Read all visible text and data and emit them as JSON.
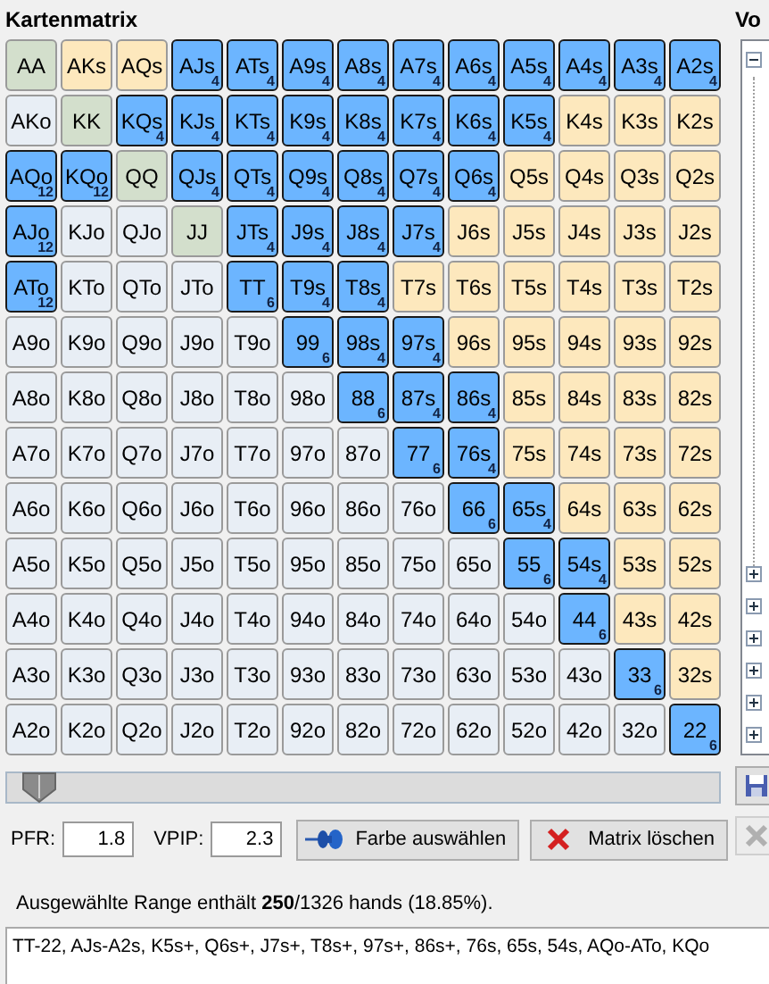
{
  "matrix": {
    "title": "Kartenmatrix",
    "rows": [
      [
        {
          "label": "AA",
          "kind": "pair",
          "selected": false
        },
        {
          "label": "AKs",
          "kind": "suited",
          "selected": false
        },
        {
          "label": "AQs",
          "kind": "suited",
          "selected": false
        },
        {
          "label": "AJs",
          "kind": "suited",
          "selected": true,
          "count": "4"
        },
        {
          "label": "ATs",
          "kind": "suited",
          "selected": true,
          "count": "4"
        },
        {
          "label": "A9s",
          "kind": "suited",
          "selected": true,
          "count": "4"
        },
        {
          "label": "A8s",
          "kind": "suited",
          "selected": true,
          "count": "4"
        },
        {
          "label": "A7s",
          "kind": "suited",
          "selected": true,
          "count": "4"
        },
        {
          "label": "A6s",
          "kind": "suited",
          "selected": true,
          "count": "4"
        },
        {
          "label": "A5s",
          "kind": "suited",
          "selected": true,
          "count": "4"
        },
        {
          "label": "A4s",
          "kind": "suited",
          "selected": true,
          "count": "4"
        },
        {
          "label": "A3s",
          "kind": "suited",
          "selected": true,
          "count": "4"
        },
        {
          "label": "A2s",
          "kind": "suited",
          "selected": true,
          "count": "4"
        }
      ],
      [
        {
          "label": "AKo",
          "kind": "offsuit",
          "selected": false
        },
        {
          "label": "KK",
          "kind": "pair",
          "selected": false
        },
        {
          "label": "KQs",
          "kind": "suited",
          "selected": true,
          "count": "4"
        },
        {
          "label": "KJs",
          "kind": "suited",
          "selected": true,
          "count": "4"
        },
        {
          "label": "KTs",
          "kind": "suited",
          "selected": true,
          "count": "4"
        },
        {
          "label": "K9s",
          "kind": "suited",
          "selected": true,
          "count": "4"
        },
        {
          "label": "K8s",
          "kind": "suited",
          "selected": true,
          "count": "4"
        },
        {
          "label": "K7s",
          "kind": "suited",
          "selected": true,
          "count": "4"
        },
        {
          "label": "K6s",
          "kind": "suited",
          "selected": true,
          "count": "4"
        },
        {
          "label": "K5s",
          "kind": "suited",
          "selected": true,
          "count": "4"
        },
        {
          "label": "K4s",
          "kind": "suited",
          "selected": false
        },
        {
          "label": "K3s",
          "kind": "suited",
          "selected": false
        },
        {
          "label": "K2s",
          "kind": "suited",
          "selected": false
        }
      ],
      [
        {
          "label": "AQo",
          "kind": "offsuit",
          "selected": true,
          "count": "12"
        },
        {
          "label": "KQo",
          "kind": "offsuit",
          "selected": true,
          "count": "12"
        },
        {
          "label": "QQ",
          "kind": "pair",
          "selected": false
        },
        {
          "label": "QJs",
          "kind": "suited",
          "selected": true,
          "count": "4"
        },
        {
          "label": "QTs",
          "kind": "suited",
          "selected": true,
          "count": "4"
        },
        {
          "label": "Q9s",
          "kind": "suited",
          "selected": true,
          "count": "4"
        },
        {
          "label": "Q8s",
          "kind": "suited",
          "selected": true,
          "count": "4"
        },
        {
          "label": "Q7s",
          "kind": "suited",
          "selected": true,
          "count": "4"
        },
        {
          "label": "Q6s",
          "kind": "suited",
          "selected": true,
          "count": "4"
        },
        {
          "label": "Q5s",
          "kind": "suited",
          "selected": false
        },
        {
          "label": "Q4s",
          "kind": "suited",
          "selected": false
        },
        {
          "label": "Q3s",
          "kind": "suited",
          "selected": false
        },
        {
          "label": "Q2s",
          "kind": "suited",
          "selected": false
        }
      ],
      [
        {
          "label": "AJo",
          "kind": "offsuit",
          "selected": true,
          "count": "12"
        },
        {
          "label": "KJo",
          "kind": "offsuit",
          "selected": false
        },
        {
          "label": "QJo",
          "kind": "offsuit",
          "selected": false
        },
        {
          "label": "JJ",
          "kind": "pair",
          "selected": false
        },
        {
          "label": "JTs",
          "kind": "suited",
          "selected": true,
          "count": "4"
        },
        {
          "label": "J9s",
          "kind": "suited",
          "selected": true,
          "count": "4"
        },
        {
          "label": "J8s",
          "kind": "suited",
          "selected": true,
          "count": "4"
        },
        {
          "label": "J7s",
          "kind": "suited",
          "selected": true,
          "count": "4"
        },
        {
          "label": "J6s",
          "kind": "suited",
          "selected": false
        },
        {
          "label": "J5s",
          "kind": "suited",
          "selected": false
        },
        {
          "label": "J4s",
          "kind": "suited",
          "selected": false
        },
        {
          "label": "J3s",
          "kind": "suited",
          "selected": false
        },
        {
          "label": "J2s",
          "kind": "suited",
          "selected": false
        }
      ],
      [
        {
          "label": "ATo",
          "kind": "offsuit",
          "selected": true,
          "count": "12"
        },
        {
          "label": "KTo",
          "kind": "offsuit",
          "selected": false
        },
        {
          "label": "QTo",
          "kind": "offsuit",
          "selected": false
        },
        {
          "label": "JTo",
          "kind": "offsuit",
          "selected": false
        },
        {
          "label": "TT",
          "kind": "pair",
          "selected": true,
          "count": "6"
        },
        {
          "label": "T9s",
          "kind": "suited",
          "selected": true,
          "count": "4"
        },
        {
          "label": "T8s",
          "kind": "suited",
          "selected": true,
          "count": "4"
        },
        {
          "label": "T7s",
          "kind": "suited",
          "selected": false
        },
        {
          "label": "T6s",
          "kind": "suited",
          "selected": false
        },
        {
          "label": "T5s",
          "kind": "suited",
          "selected": false
        },
        {
          "label": "T4s",
          "kind": "suited",
          "selected": false
        },
        {
          "label": "T3s",
          "kind": "suited",
          "selected": false
        },
        {
          "label": "T2s",
          "kind": "suited",
          "selected": false
        }
      ],
      [
        {
          "label": "A9o",
          "kind": "offsuit",
          "selected": false
        },
        {
          "label": "K9o",
          "kind": "offsuit",
          "selected": false
        },
        {
          "label": "Q9o",
          "kind": "offsuit",
          "selected": false
        },
        {
          "label": "J9o",
          "kind": "offsuit",
          "selected": false
        },
        {
          "label": "T9o",
          "kind": "offsuit",
          "selected": false
        },
        {
          "label": "99",
          "kind": "pair",
          "selected": true,
          "count": "6"
        },
        {
          "label": "98s",
          "kind": "suited",
          "selected": true,
          "count": "4"
        },
        {
          "label": "97s",
          "kind": "suited",
          "selected": true,
          "count": "4"
        },
        {
          "label": "96s",
          "kind": "suited",
          "selected": false
        },
        {
          "label": "95s",
          "kind": "suited",
          "selected": false
        },
        {
          "label": "94s",
          "kind": "suited",
          "selected": false
        },
        {
          "label": "93s",
          "kind": "suited",
          "selected": false
        },
        {
          "label": "92s",
          "kind": "suited",
          "selected": false
        }
      ],
      [
        {
          "label": "A8o",
          "kind": "offsuit",
          "selected": false
        },
        {
          "label": "K8o",
          "kind": "offsuit",
          "selected": false
        },
        {
          "label": "Q8o",
          "kind": "offsuit",
          "selected": false
        },
        {
          "label": "J8o",
          "kind": "offsuit",
          "selected": false
        },
        {
          "label": "T8o",
          "kind": "offsuit",
          "selected": false
        },
        {
          "label": "98o",
          "kind": "offsuit",
          "selected": false
        },
        {
          "label": "88",
          "kind": "pair",
          "selected": true,
          "count": "6"
        },
        {
          "label": "87s",
          "kind": "suited",
          "selected": true,
          "count": "4"
        },
        {
          "label": "86s",
          "kind": "suited",
          "selected": true,
          "count": "4"
        },
        {
          "label": "85s",
          "kind": "suited",
          "selected": false
        },
        {
          "label": "84s",
          "kind": "suited",
          "selected": false
        },
        {
          "label": "83s",
          "kind": "suited",
          "selected": false
        },
        {
          "label": "82s",
          "kind": "suited",
          "selected": false
        }
      ],
      [
        {
          "label": "A7o",
          "kind": "offsuit",
          "selected": false
        },
        {
          "label": "K7o",
          "kind": "offsuit",
          "selected": false
        },
        {
          "label": "Q7o",
          "kind": "offsuit",
          "selected": false
        },
        {
          "label": "J7o",
          "kind": "offsuit",
          "selected": false
        },
        {
          "label": "T7o",
          "kind": "offsuit",
          "selected": false
        },
        {
          "label": "97o",
          "kind": "offsuit",
          "selected": false
        },
        {
          "label": "87o",
          "kind": "offsuit",
          "selected": false
        },
        {
          "label": "77",
          "kind": "pair",
          "selected": true,
          "count": "6"
        },
        {
          "label": "76s",
          "kind": "suited",
          "selected": true,
          "count": "4"
        },
        {
          "label": "75s",
          "kind": "suited",
          "selected": false
        },
        {
          "label": "74s",
          "kind": "suited",
          "selected": false
        },
        {
          "label": "73s",
          "kind": "suited",
          "selected": false
        },
        {
          "label": "72s",
          "kind": "suited",
          "selected": false
        }
      ],
      [
        {
          "label": "A6o",
          "kind": "offsuit",
          "selected": false
        },
        {
          "label": "K6o",
          "kind": "offsuit",
          "selected": false
        },
        {
          "label": "Q6o",
          "kind": "offsuit",
          "selected": false
        },
        {
          "label": "J6o",
          "kind": "offsuit",
          "selected": false
        },
        {
          "label": "T6o",
          "kind": "offsuit",
          "selected": false
        },
        {
          "label": "96o",
          "kind": "offsuit",
          "selected": false
        },
        {
          "label": "86o",
          "kind": "offsuit",
          "selected": false
        },
        {
          "label": "76o",
          "kind": "offsuit",
          "selected": false
        },
        {
          "label": "66",
          "kind": "pair",
          "selected": true,
          "count": "6"
        },
        {
          "label": "65s",
          "kind": "suited",
          "selected": true,
          "count": "4"
        },
        {
          "label": "64s",
          "kind": "suited",
          "selected": false
        },
        {
          "label": "63s",
          "kind": "suited",
          "selected": false
        },
        {
          "label": "62s",
          "kind": "suited",
          "selected": false
        }
      ],
      [
        {
          "label": "A5o",
          "kind": "offsuit",
          "selected": false
        },
        {
          "label": "K5o",
          "kind": "offsuit",
          "selected": false
        },
        {
          "label": "Q5o",
          "kind": "offsuit",
          "selected": false
        },
        {
          "label": "J5o",
          "kind": "offsuit",
          "selected": false
        },
        {
          "label": "T5o",
          "kind": "offsuit",
          "selected": false
        },
        {
          "label": "95o",
          "kind": "offsuit",
          "selected": false
        },
        {
          "label": "85o",
          "kind": "offsuit",
          "selected": false
        },
        {
          "label": "75o",
          "kind": "offsuit",
          "selected": false
        },
        {
          "label": "65o",
          "kind": "offsuit",
          "selected": false
        },
        {
          "label": "55",
          "kind": "pair",
          "selected": true,
          "count": "6"
        },
        {
          "label": "54s",
          "kind": "suited",
          "selected": true,
          "count": "4"
        },
        {
          "label": "53s",
          "kind": "suited",
          "selected": false
        },
        {
          "label": "52s",
          "kind": "suited",
          "selected": false
        }
      ],
      [
        {
          "label": "A4o",
          "kind": "offsuit",
          "selected": false
        },
        {
          "label": "K4o",
          "kind": "offsuit",
          "selected": false
        },
        {
          "label": "Q4o",
          "kind": "offsuit",
          "selected": false
        },
        {
          "label": "J4o",
          "kind": "offsuit",
          "selected": false
        },
        {
          "label": "T4o",
          "kind": "offsuit",
          "selected": false
        },
        {
          "label": "94o",
          "kind": "offsuit",
          "selected": false
        },
        {
          "label": "84o",
          "kind": "offsuit",
          "selected": false
        },
        {
          "label": "74o",
          "kind": "offsuit",
          "selected": false
        },
        {
          "label": "64o",
          "kind": "offsuit",
          "selected": false
        },
        {
          "label": "54o",
          "kind": "offsuit",
          "selected": false
        },
        {
          "label": "44",
          "kind": "pair",
          "selected": true,
          "count": "6"
        },
        {
          "label": "43s",
          "kind": "suited",
          "selected": false
        },
        {
          "label": "42s",
          "kind": "suited",
          "selected": false
        }
      ],
      [
        {
          "label": "A3o",
          "kind": "offsuit",
          "selected": false
        },
        {
          "label": "K3o",
          "kind": "offsuit",
          "selected": false
        },
        {
          "label": "Q3o",
          "kind": "offsuit",
          "selected": false
        },
        {
          "label": "J3o",
          "kind": "offsuit",
          "selected": false
        },
        {
          "label": "T3o",
          "kind": "offsuit",
          "selected": false
        },
        {
          "label": "93o",
          "kind": "offsuit",
          "selected": false
        },
        {
          "label": "83o",
          "kind": "offsuit",
          "selected": false
        },
        {
          "label": "73o",
          "kind": "offsuit",
          "selected": false
        },
        {
          "label": "63o",
          "kind": "offsuit",
          "selected": false
        },
        {
          "label": "53o",
          "kind": "offsuit",
          "selected": false
        },
        {
          "label": "43o",
          "kind": "offsuit",
          "selected": false
        },
        {
          "label": "33",
          "kind": "pair",
          "selected": true,
          "count": "6"
        },
        {
          "label": "32s",
          "kind": "suited",
          "selected": false
        }
      ],
      [
        {
          "label": "A2o",
          "kind": "offsuit",
          "selected": false
        },
        {
          "label": "K2o",
          "kind": "offsuit",
          "selected": false
        },
        {
          "label": "Q2o",
          "kind": "offsuit",
          "selected": false
        },
        {
          "label": "J2o",
          "kind": "offsuit",
          "selected": false
        },
        {
          "label": "T2o",
          "kind": "offsuit",
          "selected": false
        },
        {
          "label": "92o",
          "kind": "offsuit",
          "selected": false
        },
        {
          "label": "82o",
          "kind": "offsuit",
          "selected": false
        },
        {
          "label": "72o",
          "kind": "offsuit",
          "selected": false
        },
        {
          "label": "62o",
          "kind": "offsuit",
          "selected": false
        },
        {
          "label": "52o",
          "kind": "offsuit",
          "selected": false
        },
        {
          "label": "42o",
          "kind": "offsuit",
          "selected": false
        },
        {
          "label": "32o",
          "kind": "offsuit",
          "selected": false
        },
        {
          "label": "22",
          "kind": "pair",
          "selected": true,
          "count": "6"
        }
      ]
    ]
  },
  "slider": {
    "level": 0
  },
  "pfr": {
    "label": "PFR:",
    "value": "1.8"
  },
  "vpip": {
    "label": "VPIP:",
    "value": "2.3"
  },
  "buttons": [
    {
      "kind": "color",
      "label": "Farbe auswählen"
    },
    {
      "kind": "clear",
      "label": "Matrix löschen"
    }
  ],
  "side_panel": {
    "title": "Vo",
    "nodes": [
      {
        "expanded": true
      },
      {
        "expanded": false
      },
      {
        "expanded": false
      },
      {
        "expanded": false
      },
      {
        "expanded": false
      },
      {
        "expanded": false
      },
      {
        "expanded": false
      }
    ],
    "tools": [
      {
        "kind": "save",
        "disabled": false
      },
      {
        "kind": "delete",
        "disabled": true
      }
    ]
  },
  "summary": "Ausgewählte Range enthält **250**/1326 hands (18.85%).",
  "range_text": "TT-22, AJs-A2s, K5s+, Q6s+, J7s+, T8s+, 97s+, 86s+, 76s, 65s, 54s, AQo-ATo, KQo"
}
